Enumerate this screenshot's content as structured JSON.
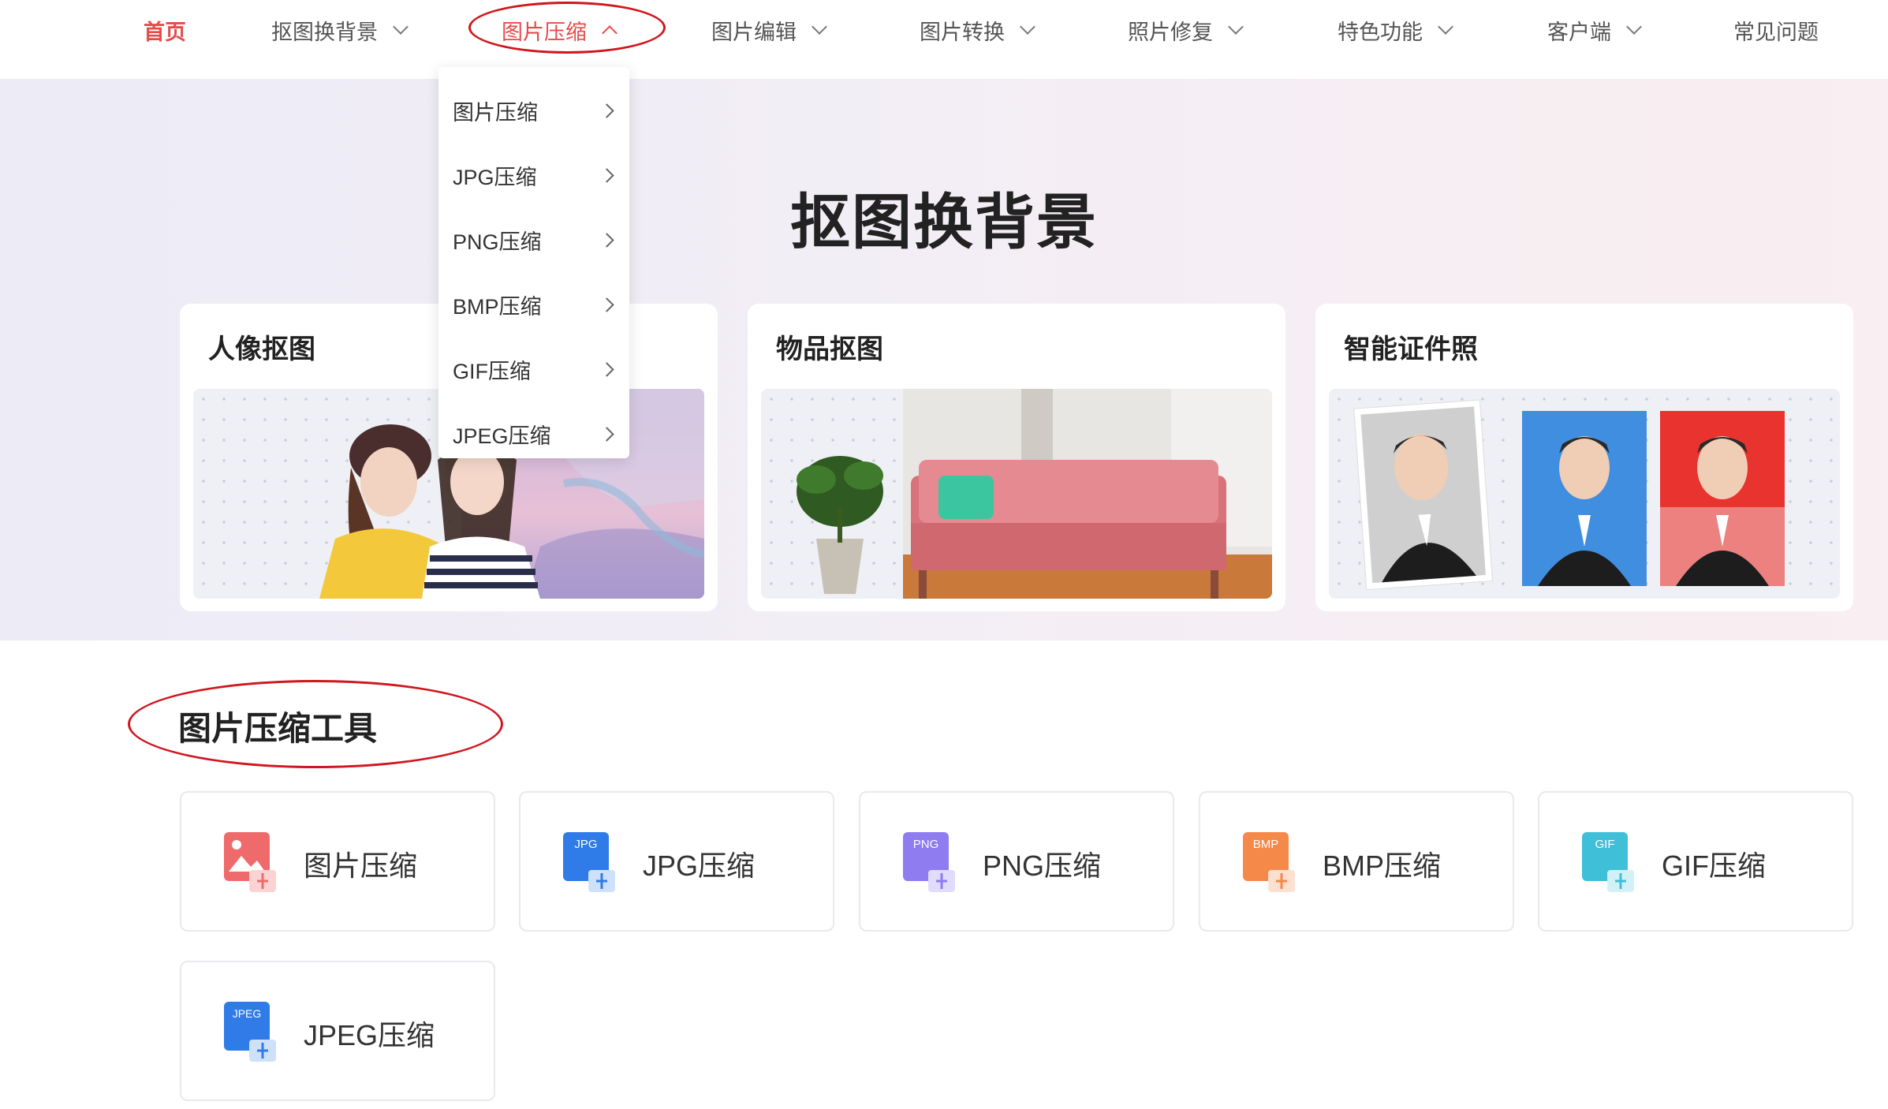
{
  "nav": {
    "home": "首页",
    "items": [
      {
        "label": "抠图换背景"
      },
      {
        "label": "图片压缩"
      },
      {
        "label": "图片编辑"
      },
      {
        "label": "图片转换"
      },
      {
        "label": "照片修复"
      },
      {
        "label": "特色功能"
      },
      {
        "label": "客户端"
      }
    ],
    "faq": "常见问题",
    "accent_color": "#e84a4a"
  },
  "dropdown": {
    "items": [
      "图片压缩",
      "JPG压缩",
      "PNG压缩",
      "BMP压缩",
      "GIF压缩",
      "JPEG压缩"
    ]
  },
  "hero": {
    "title": "抠图换背景",
    "cards": [
      {
        "title": "人像抠图"
      },
      {
        "title": "物品抠图"
      },
      {
        "title": "智能证件照"
      }
    ]
  },
  "tools": {
    "section_title": "图片压缩工具",
    "items": [
      {
        "label": "图片压缩",
        "icon": "image-compress-icon",
        "color": "#ef6b6b",
        "badge": ""
      },
      {
        "label": "JPG压缩",
        "icon": "jpg-compress-icon",
        "color": "#2f7be8",
        "badge": "JPG"
      },
      {
        "label": "PNG压缩",
        "icon": "png-compress-icon",
        "color": "#8e7cf0",
        "badge": "PNG"
      },
      {
        "label": "BMP压缩",
        "icon": "bmp-compress-icon",
        "color": "#f5894a",
        "badge": "BMP"
      },
      {
        "label": "GIF压缩",
        "icon": "gif-compress-icon",
        "color": "#3fbfd8",
        "badge": "GIF"
      },
      {
        "label": "JPEG压缩",
        "icon": "jpeg-compress-icon",
        "color": "#2f7be8",
        "badge": "JPEG"
      }
    ]
  }
}
